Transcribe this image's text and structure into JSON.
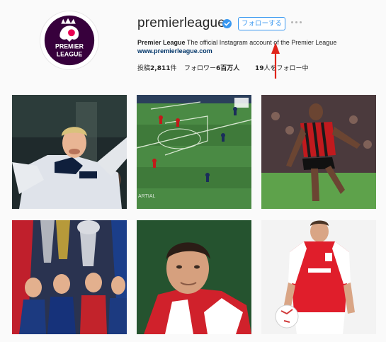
{
  "profile": {
    "username": "premierleague",
    "follow_label": "フォローする",
    "bio_name": "Premier League",
    "bio_text": " The official Instagram account of the Premier League",
    "website": "www.premierleague.com",
    "logo_text_1": "PREMIER",
    "logo_text_2": "LEAGUE"
  },
  "stats": {
    "posts_label": "投稿",
    "posts_count": "2,811",
    "posts_unit": "件",
    "followers_label": "フォロワー",
    "followers_count": "6百万人",
    "following_count": "19",
    "following_label": "人をフォロー中"
  },
  "posts": [
    {
      "id": "post-1",
      "scene": "player-celebrating-white-kit"
    },
    {
      "id": "post-2",
      "scene": "aerial-pitch-view"
    },
    {
      "id": "post-3",
      "scene": "player-dribbling-striped-kit"
    },
    {
      "id": "post-4",
      "scene": "players-with-trophy"
    },
    {
      "id": "post-5",
      "scene": "player-portrait-red-kit"
    },
    {
      "id": "post-6",
      "scene": "player-holding-ball"
    }
  ],
  "overlay_text": {
    "post2_corner": "ARTIAL"
  },
  "colors": {
    "accent": "#3897f0",
    "link": "#003569",
    "annotation": "#e0251b"
  }
}
